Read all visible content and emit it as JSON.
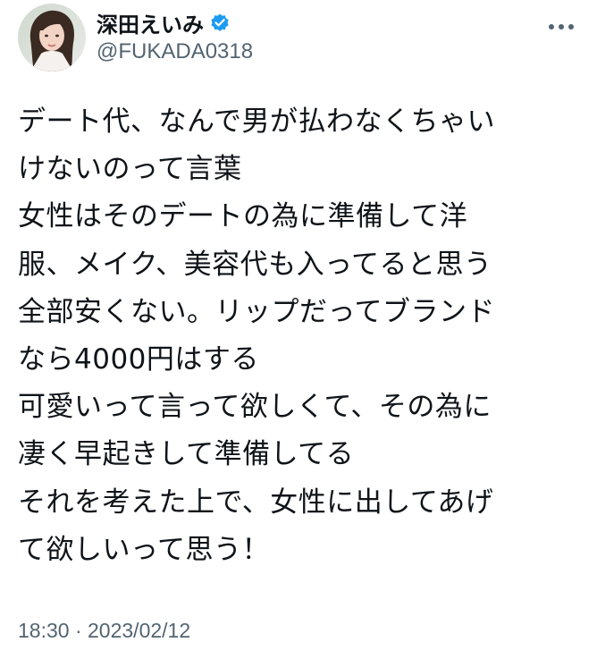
{
  "author": {
    "display_name": "深田えいみ",
    "handle": "@FUKADA0318",
    "verified_icon": "verified-badge-icon",
    "verified_color": "#1d9bf0"
  },
  "menu_icon": "more-horizontal-icon",
  "tweet": {
    "lines": [
      "デート代、なんで男が払わなくちゃい",
      "けないのって言葉",
      "女性はそのデートの為に準備して洋",
      "服、メイク、美容代も入ってると思う",
      "全部安くない。リップだってブランド",
      "なら4000円はする",
      "可愛いって言って欲しくて、その為に",
      "凄く早起きして準備してる",
      "それを考えた上で、女性に出してあげ",
      "て欲しいって思う！"
    ],
    "time": "18:30",
    "separator": "·",
    "date": "2023/02/12"
  },
  "colors": {
    "text": "#0f1419",
    "secondary": "#536471",
    "accent": "#1d9bf0"
  }
}
